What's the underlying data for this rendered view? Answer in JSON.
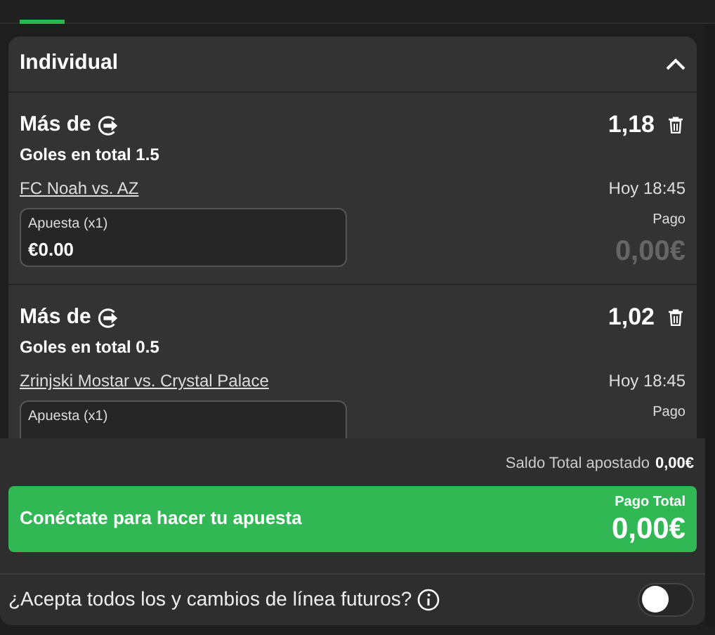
{
  "tabs": [
    {
      "selected": true
    }
  ],
  "section": {
    "title": "Individual",
    "expanded": true
  },
  "bets": [
    {
      "selection": "Más de",
      "market": "Goles en total 1.5",
      "odds": "1,18",
      "match": "FC Noah vs. AZ",
      "time": "Hoy 18:45",
      "stake_label": "Apuesta (x1)",
      "stake_value": "€0.00",
      "payout_label": "Pago",
      "payout": "0,00€"
    },
    {
      "selection": "Más de",
      "market": "Goles en total 0.5",
      "odds": "1,02",
      "match": "Zrinjski Mostar vs. Crystal Palace",
      "time": "Hoy 18:45",
      "stake_label": "Apuesta (x1)",
      "payout_label": "Pago"
    }
  ],
  "footer": {
    "total_label": "Saldo Total apostado",
    "total_value": "0,00€",
    "cta": "Conéctate para hacer tu apuesta",
    "payout_label": "Pago Total",
    "payout": "0,00€",
    "accept_label": "¿Acepta todos los y cambios de línea futuros?",
    "accept_on": false
  }
}
